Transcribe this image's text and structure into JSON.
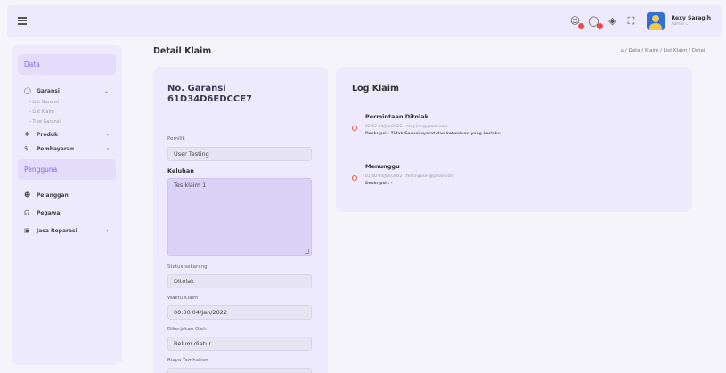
{
  "topbar": {
    "user_name": "Rexy Saragih",
    "user_role": "Admin ⌄"
  },
  "sidebar": {
    "section_data": "Data",
    "garansi": "Garansi",
    "list_garansi": "- List Garansi",
    "list_klaim": "- List Klaim",
    "tipe_garansi": "- Tipe Garansi",
    "produk": "Produk",
    "pembayaran": "Pembayaran",
    "section_pengguna": "Pengguna",
    "pelanggan": "Pelanggan",
    "pegawai": "Pegawai",
    "jasa_reparasi": "Jasa Reparasi"
  },
  "header": {
    "title": "Detail Klaim",
    "breadcrumb": "/ Data / Klaim / List Klaim / Detail"
  },
  "detail": {
    "no_garansi_label": "No. Garansi",
    "no_garansi_value": "61D34D6EDCCE7",
    "pemilik_label": "Pemilik",
    "pemilik_value": "User Testing",
    "keluhan_label": "Keluhan",
    "keluhan_value": "Tes klaim 1",
    "status_label": "Status sekarang",
    "status_value": "Ditolak",
    "waktu_label": "Waktu Klaim",
    "waktu_value": "00:00 04/Jan/2022",
    "dikerjakan_label": "Dikerjakan Oleh",
    "dikerjakan_value": "Belum diatur",
    "biaya_label": "Biaya Tambahan"
  },
  "log": {
    "title": "Log Klaim",
    "entries": [
      {
        "status": "Permintaan Ditolak",
        "meta": "02:52 04/Jan/2022 - rexy.jms@gmail.com",
        "desc": "Deskripsi : Tidak Sesuai syarat dan ketentuan yang berlaku"
      },
      {
        "status": "Menunggu",
        "meta": "02:40 04/Jan/2022 - testinguser@gmail.com",
        "desc": "Deskripsi : -"
      }
    ]
  },
  "colors": {
    "accent": "#7f6ee0",
    "card_bg": "#eeeafd",
    "badge": "#e84a4a"
  }
}
